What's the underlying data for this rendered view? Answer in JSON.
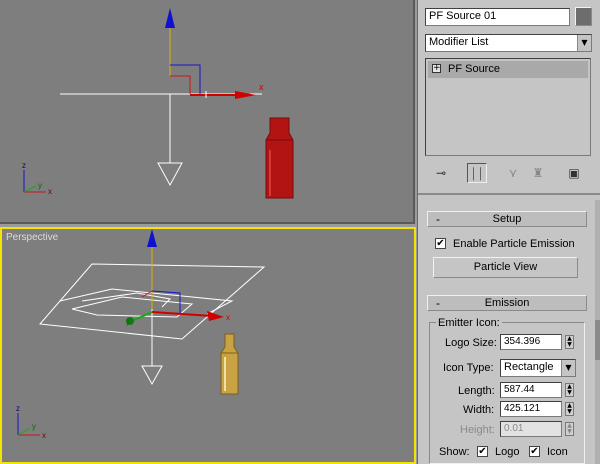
{
  "viewports": {
    "top": {
      "axis_x": "x",
      "gizmo_x": "x",
      "gizmo_y": "y",
      "gizmo_z": "z"
    },
    "perspective": {
      "label": "Perspective",
      "gizmo_x": "x",
      "gizmo_y": "y",
      "gizmo_z": "z"
    }
  },
  "panel": {
    "object_name": "PF Source 01",
    "modifier_list": "Modifier List",
    "stack_item": "PF Source",
    "stack_item_expand": "+",
    "toolbar_icons": [
      "pin-stack-icon",
      "show-end-result-icon",
      "make-unique-icon",
      "remove-modifier-icon",
      "configure-sets-icon"
    ],
    "setup": {
      "header_symbol": "-",
      "title": "Setup",
      "enable_label": "Enable Particle Emission",
      "enable_checked": true,
      "particle_view_button": "Particle View"
    },
    "emission": {
      "header_symbol": "-",
      "title": "Emission",
      "group_label": "Emitter Icon:",
      "logo_size_label": "Logo Size:",
      "logo_size_value": "354.396",
      "icon_type_label": "Icon Type:",
      "icon_type_value": "Rectangle",
      "length_label": "Length:",
      "length_value": "587.44",
      "width_label": "Width:",
      "width_value": "425.121",
      "height_label": "Height:",
      "height_value": "0.01",
      "show_label": "Show:",
      "show_logo_label": "Logo",
      "show_logo_checked": true,
      "show_icon_label": "Icon",
      "show_icon_checked": true
    }
  },
  "colors": {
    "viewport_bg": "#7e7e7e",
    "active_border": "#f4e500",
    "panel_bg": "#c5c5c5",
    "axis_red": "#d10000",
    "axis_blue": "#0000cc",
    "shell_red": "#b21414",
    "shell_gold": "#c9a341"
  }
}
